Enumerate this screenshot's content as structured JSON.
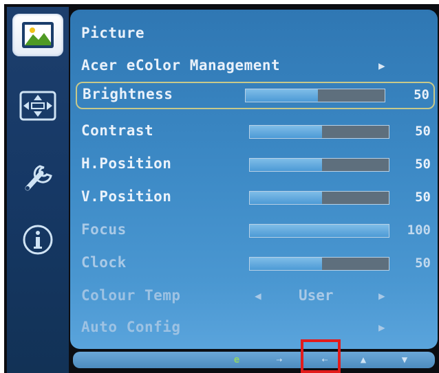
{
  "menu": {
    "title": "Picture",
    "items": [
      {
        "label": "Acer eColor Management",
        "type": "submenu"
      },
      {
        "label": "Brightness",
        "value": "50",
        "level": 0.5,
        "selected": true
      },
      {
        "label": "Contrast",
        "value": "50",
        "level": 0.5
      },
      {
        "label": "H.Position",
        "value": "50",
        "level": 0.5
      },
      {
        "label": "V.Position",
        "value": "50",
        "level": 0.5
      },
      {
        "label": "Focus",
        "value": "100",
        "level": 1.0
      },
      {
        "label": "Clock",
        "value": "50",
        "level": 0.5
      },
      {
        "label": "Colour Temp",
        "value": "User",
        "type": "selector"
      },
      {
        "label": "Auto Config",
        "type": "submenu"
      }
    ]
  },
  "sidebar": {
    "items": [
      {
        "icon": "picture-icon",
        "active": true
      },
      {
        "icon": "position-icon",
        "active": false
      },
      {
        "icon": "wrench-settings-icon",
        "active": false
      },
      {
        "icon": "info-icon",
        "active": false
      }
    ]
  },
  "keybar": {
    "keys": [
      "e-key-icon",
      "enter-icon",
      "exit-icon",
      "up-arrow-icon",
      "down-arrow-icon"
    ]
  },
  "colors": {
    "panel": "#3c89c5",
    "sidebar": "#163865",
    "highlight_border": "#e21b1b",
    "selection_border": "#c8c98a"
  }
}
